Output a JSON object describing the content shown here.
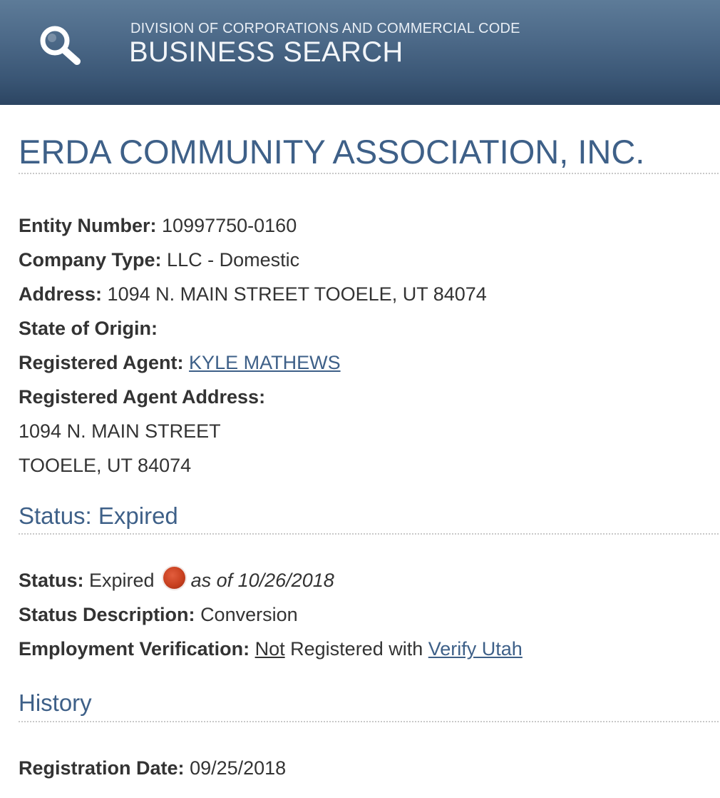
{
  "header": {
    "subtitle": "DIVISION OF CORPORATIONS AND COMMERCIAL CODE",
    "title": "BUSINESS SEARCH",
    "icon": "search-icon"
  },
  "entity": {
    "name": "ERDA COMMUNITY ASSOCIATION, INC.",
    "fields": {
      "entity_number_label": "Entity Number:",
      "entity_number": "10997750-0160",
      "company_type_label": "Company Type:",
      "company_type": "LLC - Domestic",
      "address_label": "Address:",
      "address": "1094 N. MAIN STREET TOOELE, UT 84074",
      "state_of_origin_label": "State of Origin:",
      "state_of_origin": "",
      "registered_agent_label": "Registered Agent:",
      "registered_agent": "KYLE MATHEWS",
      "registered_agent_address_label": "Registered Agent Address:",
      "registered_agent_address_line1": "1094 N. MAIN STREET",
      "registered_agent_address_line2": "TOOELE, UT 84074"
    }
  },
  "status_section": {
    "heading": "Status: Expired",
    "status_label": "Status:",
    "status_value": "Expired",
    "status_color": "#c8401f",
    "as_of": "as of 10/26/2018",
    "description_label": "Status Description:",
    "description_value": "Conversion",
    "employment_label": "Employment Verification:",
    "employment_not": "Not",
    "employment_mid": "Registered with",
    "employment_link": "Verify Utah"
  },
  "history_section": {
    "heading": "History",
    "registration_date_label": "Registration Date:",
    "registration_date": "09/25/2018"
  },
  "colors": {
    "header_top": "#5d7b98",
    "header_bottom": "#2c4562",
    "accent": "#3e6088",
    "text": "#333333"
  }
}
